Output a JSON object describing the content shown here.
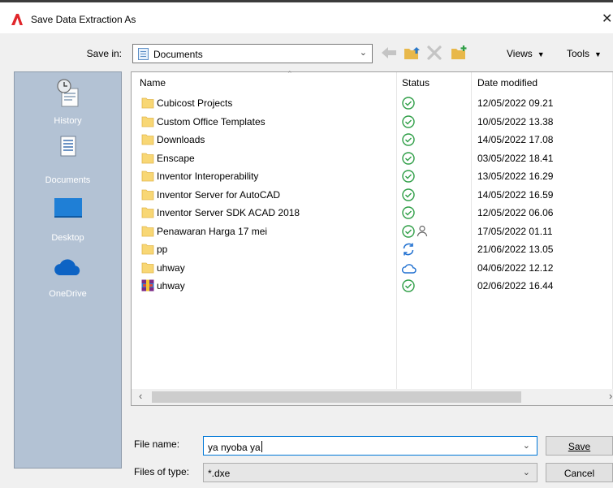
{
  "dialog": {
    "title": "Save Data Extraction As",
    "close": "✕"
  },
  "toolbar": {
    "save_in_label": "Save in:",
    "save_in_value": "Documents",
    "views_label": "Views",
    "tools_label": "Tools"
  },
  "places": [
    {
      "label": "History",
      "icon": "history-icon"
    },
    {
      "label": "Documents",
      "icon": "documents-icon"
    },
    {
      "label": "Desktop",
      "icon": "desktop-icon"
    },
    {
      "label": "OneDrive",
      "icon": "onedrive-icon"
    }
  ],
  "columns": {
    "name": "Name",
    "status": "Status",
    "date": "Date modified"
  },
  "files": [
    {
      "name": "Cubicost Projects",
      "status": "synced",
      "date": "12/05/2022 09.21",
      "icon": "folder-icon"
    },
    {
      "name": "Custom Office Templates",
      "status": "synced",
      "date": "10/05/2022 13.38",
      "icon": "folder-icon"
    },
    {
      "name": "Downloads",
      "status": "synced",
      "date": "14/05/2022 17.08",
      "icon": "folder-icon"
    },
    {
      "name": "Enscape",
      "status": "synced",
      "date": "03/05/2022 18.41",
      "icon": "folder-icon"
    },
    {
      "name": "Inventor Interoperability",
      "status": "synced",
      "date": "13/05/2022 16.29",
      "icon": "folder-icon"
    },
    {
      "name": "Inventor Server for AutoCAD",
      "status": "synced",
      "date": "14/05/2022 16.59",
      "icon": "folder-icon"
    },
    {
      "name": "Inventor Server SDK ACAD 2018",
      "status": "synced",
      "date": "12/05/2022 06.06",
      "icon": "folder-icon"
    },
    {
      "name": "Penawaran Harga 17 mei",
      "status": "shared",
      "date": "17/05/2022 01.11",
      "icon": "folder-icon"
    },
    {
      "name": "pp",
      "status": "syncing",
      "date": "21/06/2022 13.05",
      "icon": "folder-icon"
    },
    {
      "name": "uhway",
      "status": "cloud",
      "date": "04/06/2022 12.12",
      "icon": "folder-icon"
    },
    {
      "name": "uhway",
      "status": "synced",
      "date": "02/06/2022 16.44",
      "icon": "archive-icon"
    }
  ],
  "form": {
    "file_name_label": "File name:",
    "file_name_value": "ya nyoba ya",
    "file_type_label": "Files of type:",
    "file_type_value": "*.dxe",
    "save_button": "Save",
    "cancel_button": "Cancel"
  },
  "colors": {
    "places_bg": "#b3c2d4",
    "status_green": "#2e9e46",
    "status_blue": "#1e6fd0",
    "folder_yellow": "#f8d775"
  }
}
